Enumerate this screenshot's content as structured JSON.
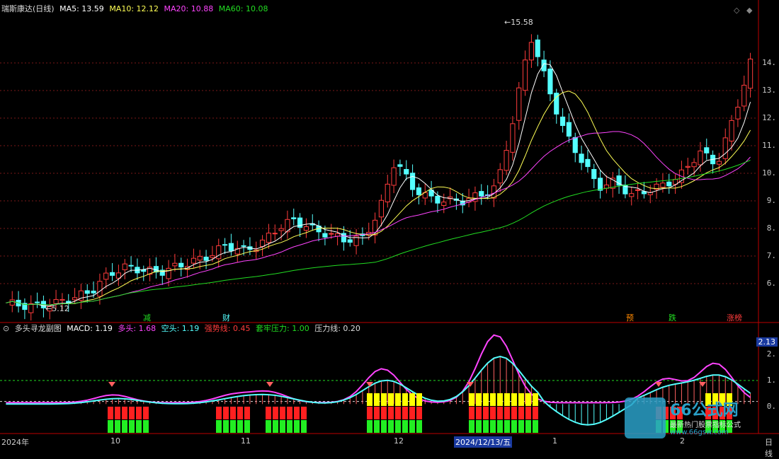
{
  "main_legend": {
    "title": "瑞斯康达(日线)",
    "ma5_label": "MA5: 13.59",
    "ma10_label": "MA10: 12.12",
    "ma20_label": "MA20: 10.88",
    "ma60_label": "MA60: 10.08"
  },
  "colors": {
    "up": "#ff3c3c",
    "down": "#54ffff",
    "ma5": "#ffffff",
    "ma10": "#ffff55",
    "ma20": "#ff44ff",
    "ma60": "#22dd22",
    "grid": "#7a1818"
  },
  "price_axis": {
    "ticks": [
      "14.",
      "13.",
      "12.",
      "11.",
      "10.",
      "9.",
      "8.",
      "7.",
      "6."
    ]
  },
  "annotations": {
    "high": "15.58",
    "low": "5.12"
  },
  "event_markers": [
    {
      "label": "减",
      "color": "#22dd22"
    },
    {
      "label": "财",
      "color": "#54ffff"
    },
    {
      "label": "预",
      "color": "#ff8800"
    },
    {
      "label": "跌",
      "color": "#22dd22"
    },
    {
      "label": "涨榜",
      "color": "#ff3c3c"
    }
  ],
  "sub_legend": {
    "title": "多头寻龙副图",
    "macd": "MACD: 1.19",
    "duotou": "多头: 1.68",
    "kongtou": "空头: 1.19",
    "qiangshi": "强势线: 0.45",
    "taolao": "套牢压力: 1.00",
    "yali": "压力线: 0.20"
  },
  "sub_axis": {
    "ticks": [
      "2.",
      "1.",
      "0."
    ],
    "current": "2.13"
  },
  "x_axis": {
    "labels": [
      "2024年",
      "10",
      "11",
      "12",
      "2024/12/13/五",
      "1",
      "2"
    ],
    "period": "日线"
  },
  "watermark": {
    "brand": "66公式网",
    "sub": "最新热门股票指标公式",
    "url": "www.66gsw.com"
  },
  "chart_data": {
    "type": "line",
    "title": "瑞斯康达(日线)",
    "ylim": [
      5,
      16
    ],
    "high": 15.58,
    "low": 5.12,
    "series": [
      {
        "name": "MA5",
        "last": 13.59
      },
      {
        "name": "MA10",
        "last": 12.12
      },
      {
        "name": "MA20",
        "last": 10.88
      },
      {
        "name": "MA60",
        "last": 10.08
      }
    ],
    "close_path": [
      5.3,
      5.2,
      5.2,
      5.3,
      5.5,
      5.7,
      6.3,
      6.6,
      6.5,
      6.4,
      6.6,
      6.8,
      7.0,
      7.4,
      7.2,
      7.4,
      8.0,
      8.3,
      8.0,
      7.8,
      7.6,
      7.6,
      8.5,
      10.5,
      9.5,
      9.1,
      9.0,
      9.0,
      9.2,
      9.5,
      12.0,
      15.0,
      13.2,
      11.5,
      10.5,
      9.5,
      9.7,
      9.2,
      9.4,
      9.6,
      10.0,
      10.8,
      10.3,
      12.0,
      14.0
    ],
    "sub_series": [
      {
        "name": "MACD",
        "last": 1.19
      },
      {
        "name": "多头",
        "last": 1.68
      },
      {
        "name": "空头",
        "last": 1.19
      },
      {
        "name": "强势线",
        "last": 0.45
      },
      {
        "name": "套牢压力",
        "last": 1.0
      },
      {
        "name": "压力线",
        "last": 0.2
      }
    ]
  }
}
